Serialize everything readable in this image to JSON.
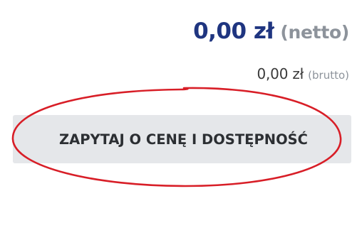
{
  "pricing": {
    "net_price": "0,00 zł",
    "net_suffix": "(netto)",
    "gross_price": "0,00 zł",
    "gross_suffix": "(brutto)"
  },
  "actions": {
    "ask_button_label": "ZAPYTAJ O CENĘ I DOSTĘPNOŚĆ"
  },
  "colors": {
    "net_price": "#1f3580",
    "muted": "#8d939b",
    "button_bg": "#e5e7ea",
    "button_text": "#2c2f33",
    "annotation_circle": "#d81e27"
  }
}
